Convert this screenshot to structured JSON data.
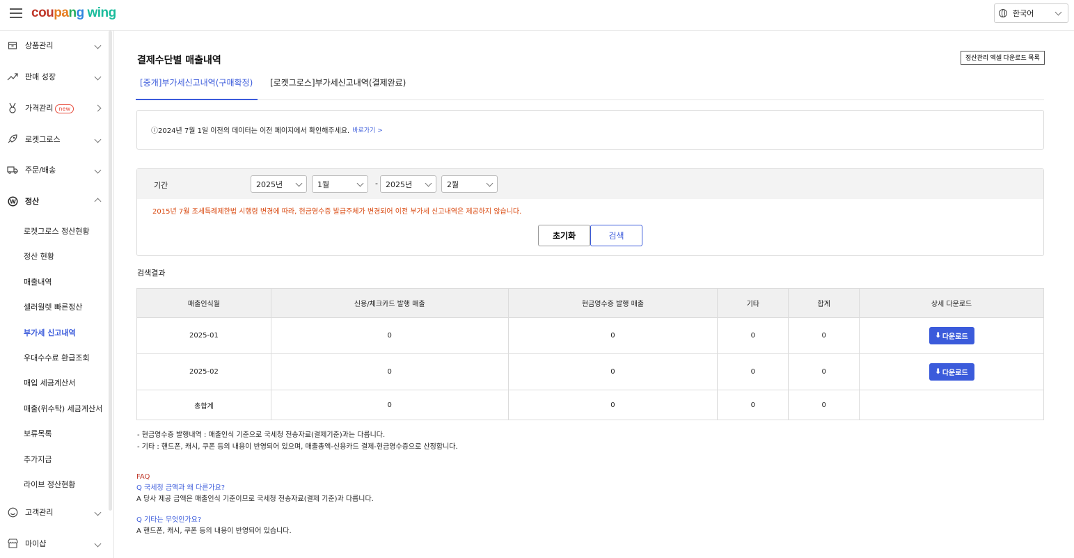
{
  "header": {
    "logo_parts": [
      "cou",
      "pa",
      "n",
      "g"
    ],
    "logo_wing": " wing",
    "language": "한국어"
  },
  "sidebar": {
    "items": [
      {
        "label": "상품관리",
        "icon": "box-icon"
      },
      {
        "label": "판매 성장",
        "icon": "trend-icon"
      },
      {
        "label": "가격관리",
        "icon": "medal-icon",
        "badge": "new"
      },
      {
        "label": "로켓그로스",
        "icon": "rocket-icon"
      },
      {
        "label": "주문/배송",
        "icon": "truck-icon"
      },
      {
        "label": "정산",
        "icon": "won-icon"
      },
      {
        "label": "고객관리",
        "icon": "smile-icon"
      },
      {
        "label": "마이샵",
        "icon": "shop-icon"
      }
    ],
    "sub_items": [
      "로켓그로스 정산현황",
      "정산 현황",
      "매출내역",
      "셀러월렛 빠른정산",
      "부가세 신고내역",
      "우대수수료 환급조회",
      "매입 세금계산서",
      "매출(위수탁) 세금계산서",
      "보류목록",
      "추가지급",
      "라이브 정산현황"
    ]
  },
  "page": {
    "title": "결제수단별 매출내역",
    "download_list_button": "정산관리 엑셀 다운로드 목록",
    "tabs": [
      "[중개]부가세신고내역(구매확정)",
      "[로켓그로스]부가세신고내역(결제완료)"
    ],
    "info_text": "ⓘ2024년 7월 1일 이전의 데이터는 이전 페이지에서 확인해주세요.",
    "info_link": "바로가기 >"
  },
  "filter": {
    "label": "기간",
    "start_year": "2025년",
    "start_month": "1월",
    "dash": "-",
    "end_year": "2025년",
    "end_month": "2월",
    "warning": "2015년 7월 조세특례제한법 시행령 변경에 따라, 현금영수증 발급주체가 변경되어 이전 부가세 신고내역은 제공하지 않습니다.",
    "reset_button": "초기화",
    "search_button": "검색"
  },
  "results": {
    "label": "검색결과",
    "headers": [
      "매출인식월",
      "신용/체크카드 발행 매출",
      "현금영수증 발행 매출",
      "기타",
      "합계",
      "상세 다운로드"
    ],
    "rows": [
      {
        "month": "2025-01",
        "card": "0",
        "cash": "0",
        "etc": "0",
        "sum": "0",
        "download": "다운로드"
      },
      {
        "month": "2025-02",
        "card": "0",
        "cash": "0",
        "etc": "0",
        "sum": "0",
        "download": "다운로드"
      }
    ],
    "total": {
      "month": "총합계",
      "card": "0",
      "cash": "0",
      "etc": "0",
      "sum": "0"
    }
  },
  "notes": [
    "- 현금영수증 발행내역 : 매출인식 기준으로 국세청 전송자료(결제기준)과는 다릅니다.",
    "- 기타 : 핸드폰, 캐시, 쿠폰 등의 내용이 반영되어 있으며, 매출총액-신용카드 결제-현금영수증으로 산정합니다."
  ],
  "faq": {
    "title": "FAQ",
    "items": [
      {
        "q": "Q 국세청 금액과 왜 다른가요?",
        "a": "A 당사 제공 금액은 매출인식 기준이므로 국세청 전송자료(결제 기준)과 다릅니다."
      },
      {
        "q": "Q 기타는 무엇인가요?",
        "a": "A 핸드폰, 캐시, 쿠폰 등의 내용이 반영되어 있습니다."
      }
    ]
  }
}
